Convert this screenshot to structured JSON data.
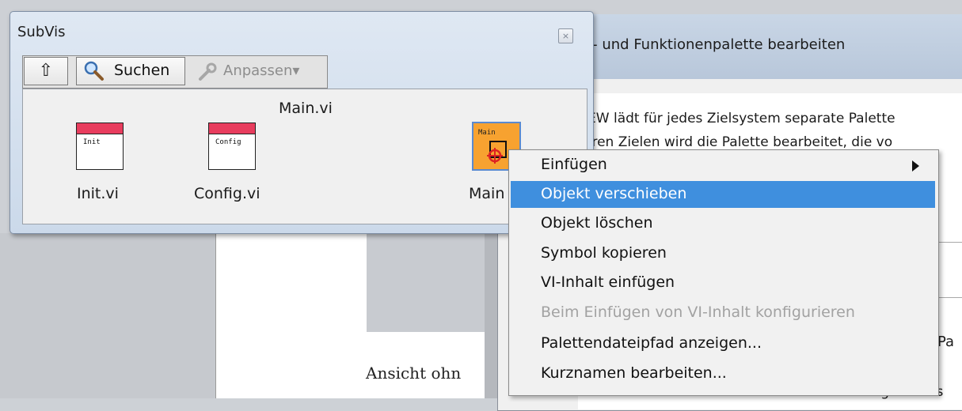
{
  "subvis": {
    "title": "SubVis",
    "close_glyph": "×",
    "up_glyph": "⇧",
    "search_label": "Suchen",
    "adjust_label": "Anpassen▾",
    "heading": "Main.vi",
    "items": [
      {
        "label": "Init.vi",
        "icon_text": "Init"
      },
      {
        "label": "Config.vi",
        "icon_text": "Config"
      },
      {
        "label": "Main",
        "icon_text": "Main"
      }
    ]
  },
  "dialog": {
    "title": "te- und Funktionenpalette bearbeiten",
    "line1": "IEW lädt für jedes Zielsystem separate Palette",
    "line2": "eren Zielen wird die Palette bearbeitet, die vo",
    "side_label": "Pa",
    "bottom_fragment": "Änderungen vor s"
  },
  "document": {
    "text": "Ansicht ohn"
  },
  "context_menu": {
    "items": [
      {
        "label": "Einfügen",
        "submenu": true,
        "enabled": true
      },
      {
        "label": "Objekt verschieben",
        "highlighted": true,
        "enabled": true
      },
      {
        "label": "Objekt löschen",
        "enabled": true
      },
      {
        "label": "Symbol kopieren",
        "enabled": true
      },
      {
        "label": "VI-Inhalt einfügen",
        "enabled": true
      },
      {
        "label": "Beim Einfügen von VI-Inhalt konfigurieren",
        "enabled": false
      },
      {
        "label": "Palettendateipfad anzeigen...",
        "enabled": true
      },
      {
        "label": "Kurznamen bearbeiten...",
        "enabled": true
      }
    ]
  },
  "colors": {
    "highlight": "#3f8fde",
    "vi_header": "#e83d5e",
    "main_icon": "#f7a230"
  }
}
